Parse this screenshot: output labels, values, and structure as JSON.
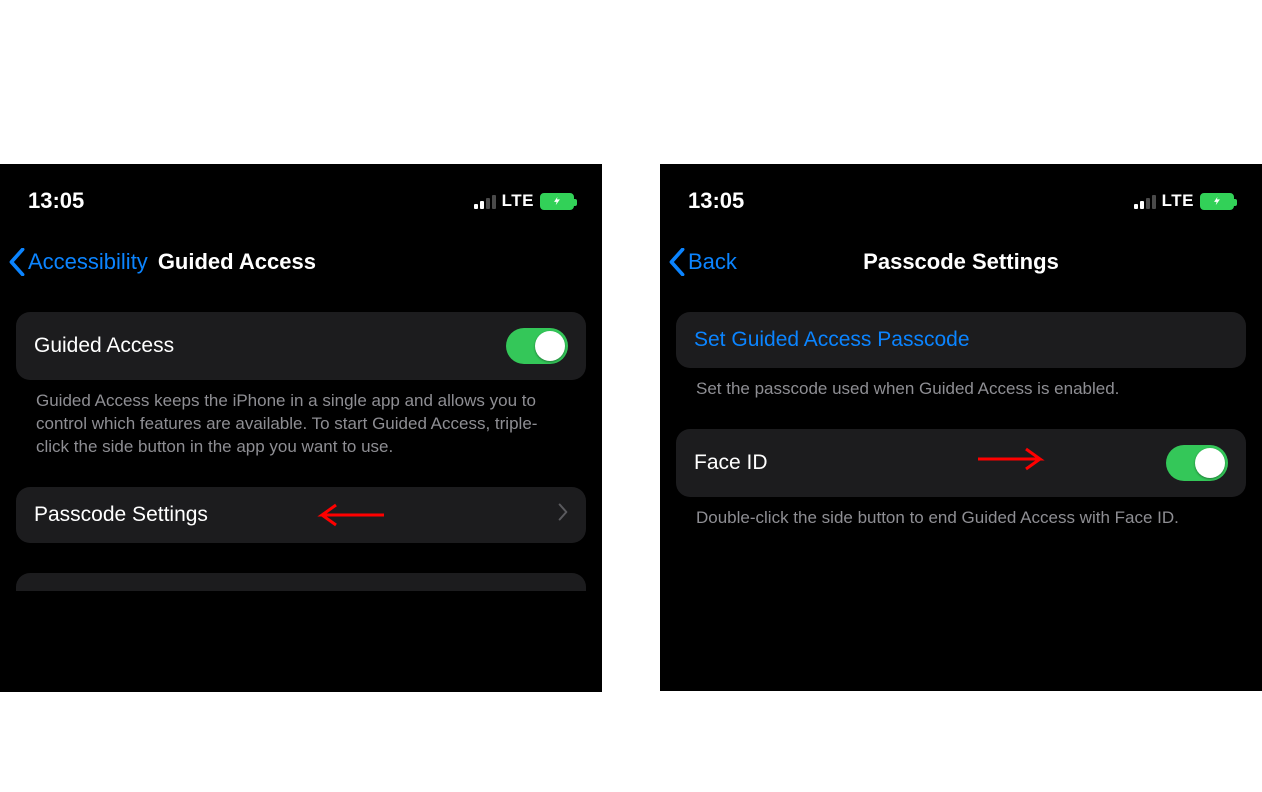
{
  "statusbar": {
    "time": "13:05",
    "network_label": "LTE"
  },
  "left_screen": {
    "nav": {
      "back_label": "Accessibility",
      "title": "Guided Access"
    },
    "toggle_row": {
      "label": "Guided Access"
    },
    "toggle_footer": "Guided Access keeps the iPhone in a single app and allows you to control which features are available. To start Guided Access, triple-click the side button in the app you want to use.",
    "passcode_row": {
      "label": "Passcode Settings"
    }
  },
  "right_screen": {
    "nav": {
      "back_label": "Back",
      "title": "Passcode Settings"
    },
    "set_row": {
      "label": "Set Guided Access Passcode"
    },
    "set_footer": "Set the passcode used when Guided Access is enabled.",
    "faceid_row": {
      "label": "Face ID"
    },
    "faceid_footer": "Double-click the side button to end Guided Access with Face ID."
  }
}
